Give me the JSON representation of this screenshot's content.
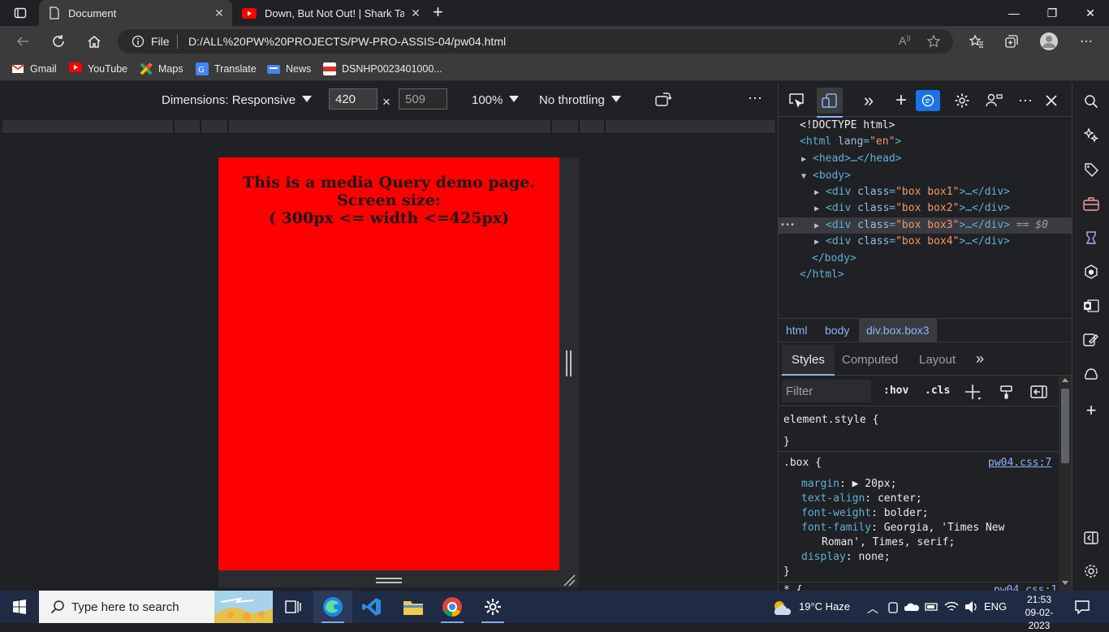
{
  "browser": {
    "tabs": [
      {
        "title": "Document",
        "close": "✕"
      },
      {
        "title": "Down, But Not Out! | Shark Tank",
        "close": "✕"
      }
    ],
    "new_tab": "+",
    "window": {
      "minimize": "—",
      "maximize": "❐",
      "close": "✕"
    },
    "address": {
      "scheme": "File",
      "url": "D:/ALL%20PW%20PROJECTS/PW-PRO-ASSIS-04/pw04.html"
    },
    "bookmarks": [
      "Gmail",
      "YouTube",
      "Maps",
      "Translate",
      "News",
      "DSNHP0023401000..."
    ]
  },
  "device_toolbar": {
    "dimensions": "Dimensions: Responsive",
    "width": "420",
    "times": "×",
    "height": "509",
    "zoom": "100%",
    "throttling": "No throttling",
    "more": "⋯"
  },
  "page": {
    "line1": "This is a media Query demo page.",
    "line2": "Screen size:",
    "line3": "( 300px <= width <=425px)"
  },
  "devtools": {
    "dom": {
      "doctype": "<!DOCTYPE html>",
      "html_open_tag": "<html",
      "html_attr": "lang",
      "html_val": "\"en\"",
      "head": "<head>…</head>",
      "body_open": "<body>",
      "div_tag": "<div",
      "div_attr": "class",
      "box1": "\"box box1\"",
      "box2": "\"box box2\"",
      "box3": "\"box box3\"",
      "box4": "\"box box4\"",
      "div_close": ">…</div>",
      "selected_marker": "== $0",
      "dots": "•••",
      "body_close": "</body>",
      "html_close": "</html>"
    },
    "breadcrumbs": [
      "html",
      "body",
      "div.box.box3"
    ],
    "panel_tabs": [
      "Styles",
      "Computed",
      "Layout",
      "»"
    ],
    "filter_placeholder": "Filter",
    "hov": ":hov",
    "cls": ".cls",
    "styles": {
      "element_style": "element.style {",
      "close_brace": "}",
      "box_selector": ".box {",
      "source": "pw04.css:7",
      "rules": [
        {
          "prop": "margin",
          "value": "▶ 20px;"
        },
        {
          "prop": "text-align",
          "value": "center;"
        },
        {
          "prop": "font-weight",
          "value": "bolder;"
        },
        {
          "prop": "font-family",
          "value": "Georgia, 'Times New"
        },
        {
          "prop": "",
          "value": "Roman', Times, serif;"
        },
        {
          "prop": "display",
          "value": "none;"
        }
      ],
      "partial_next": "* {",
      "partial_source": "pw04.css:1"
    }
  },
  "taskbar": {
    "search_placeholder": "Type here to search",
    "weather": "19°C  Haze",
    "language": "ENG",
    "time": "21:53",
    "date": "09-02-2023"
  },
  "colors": {
    "page_bg": "#ff0000",
    "accent": "#1a73e8",
    "selector": "#5db0d7"
  }
}
